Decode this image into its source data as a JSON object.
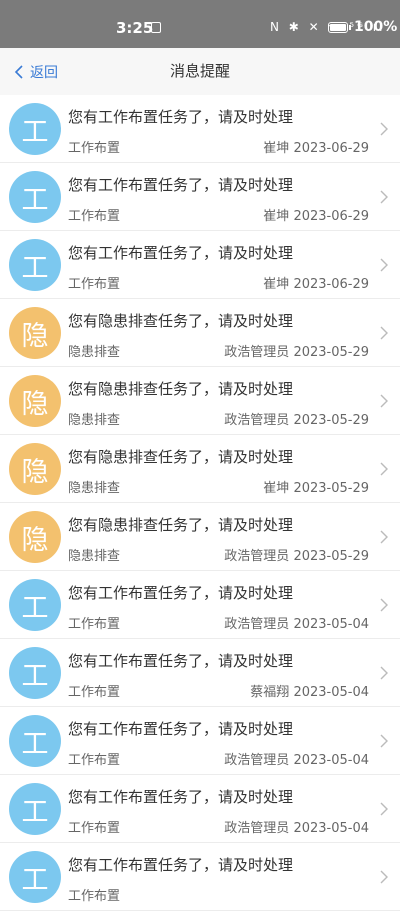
{
  "status_bar": {
    "time": "3:25",
    "icons": "N ✱ ✕ ᯤ ⁵ᴳ.ıl",
    "battery": "100%"
  },
  "nav": {
    "back_label": "返回",
    "title": "消息提醒"
  },
  "colors": {
    "work_avatar": "#7cc8ef",
    "hazard_avatar": "#f3c16e",
    "back_link": "#3a7bd5"
  },
  "messages": [
    {
      "avatar_char": "工",
      "avatar_color": "#7cc8ef",
      "title": "您有工作布置任务了，请及时处理",
      "type": "工作布置",
      "sender": "崔坤",
      "date": "2023-06-29"
    },
    {
      "avatar_char": "工",
      "avatar_color": "#7cc8ef",
      "title": "您有工作布置任务了，请及时处理",
      "type": "工作布置",
      "sender": "崔坤",
      "date": "2023-06-29"
    },
    {
      "avatar_char": "工",
      "avatar_color": "#7cc8ef",
      "title": "您有工作布置任务了，请及时处理",
      "type": "工作布置",
      "sender": "崔坤",
      "date": "2023-06-29"
    },
    {
      "avatar_char": "隐",
      "avatar_color": "#f3c16e",
      "title": "您有隐患排查任务了，请及时处理",
      "type": "隐患排查",
      "sender": "政浩管理员",
      "date": "2023-05-29"
    },
    {
      "avatar_char": "隐",
      "avatar_color": "#f3c16e",
      "title": "您有隐患排查任务了，请及时处理",
      "type": "隐患排查",
      "sender": "政浩管理员",
      "date": "2023-05-29"
    },
    {
      "avatar_char": "隐",
      "avatar_color": "#f3c16e",
      "title": "您有隐患排查任务了，请及时处理",
      "type": "隐患排查",
      "sender": "崔坤",
      "date": "2023-05-29"
    },
    {
      "avatar_char": "隐",
      "avatar_color": "#f3c16e",
      "title": "您有隐患排查任务了，请及时处理",
      "type": "隐患排查",
      "sender": "政浩管理员",
      "date": "2023-05-29"
    },
    {
      "avatar_char": "工",
      "avatar_color": "#7cc8ef",
      "title": "您有工作布置任务了，请及时处理",
      "type": "工作布置",
      "sender": "政浩管理员",
      "date": "2023-05-04"
    },
    {
      "avatar_char": "工",
      "avatar_color": "#7cc8ef",
      "title": "您有工作布置任务了，请及时处理",
      "type": "工作布置",
      "sender": "蔡福翔",
      "date": "2023-05-04"
    },
    {
      "avatar_char": "工",
      "avatar_color": "#7cc8ef",
      "title": "您有工作布置任务了，请及时处理",
      "type": "工作布置",
      "sender": "政浩管理员",
      "date": "2023-05-04"
    },
    {
      "avatar_char": "工",
      "avatar_color": "#7cc8ef",
      "title": "您有工作布置任务了，请及时处理",
      "type": "工作布置",
      "sender": "政浩管理员",
      "date": "2023-05-04"
    },
    {
      "avatar_char": "工",
      "avatar_color": "#7cc8ef",
      "title": "您有工作布置任务了，请及时处理",
      "type": "工作布置",
      "sender": "",
      "date": ""
    }
  ]
}
